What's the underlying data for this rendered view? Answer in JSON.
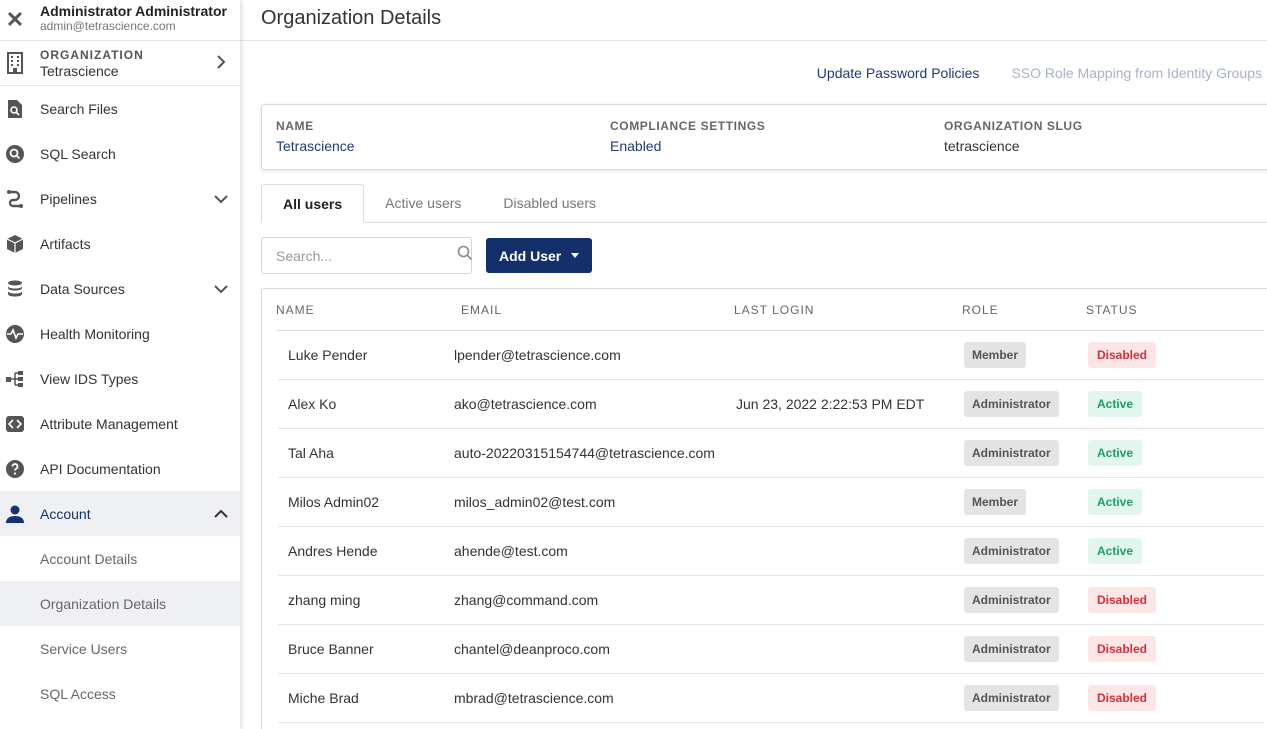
{
  "user": {
    "name": "Administrator Administrator",
    "email": "admin@tetrascience.com"
  },
  "org": {
    "label": "ORGANIZATION",
    "name": "Tetrascience"
  },
  "nav": [
    {
      "id": "search-files",
      "label": "Search Files",
      "icon": "search-file-icon"
    },
    {
      "id": "sql-search",
      "label": "SQL Search",
      "icon": "magnifier-icon"
    },
    {
      "id": "pipelines",
      "label": "Pipelines",
      "icon": "pipeline-icon",
      "chevron": "down"
    },
    {
      "id": "artifacts",
      "label": "Artifacts",
      "icon": "cube-icon"
    },
    {
      "id": "data-sources",
      "label": "Data Sources",
      "icon": "database-icon",
      "chevron": "down"
    },
    {
      "id": "health-monitoring",
      "label": "Health Monitoring",
      "icon": "heartbeat-icon"
    },
    {
      "id": "view-ids-types",
      "label": "View IDS Types",
      "icon": "hierarchy-icon"
    },
    {
      "id": "attribute-management",
      "label": "Attribute Management",
      "icon": "code-icon"
    },
    {
      "id": "api-documentation",
      "label": "API Documentation",
      "icon": "question-icon"
    },
    {
      "id": "account",
      "label": "Account",
      "icon": "person-icon",
      "chevron": "up",
      "active": true
    }
  ],
  "account_sub": [
    {
      "label": "Account Details"
    },
    {
      "label": "Organization Details",
      "selected": true
    },
    {
      "label": "Service Users"
    },
    {
      "label": "SQL Access"
    }
  ],
  "page": {
    "title": "Organization Details",
    "links": {
      "update_password": "Update Password Policies",
      "sso_mapping": "SSO Role Mapping from Identity Groups"
    }
  },
  "summary": {
    "name_label": "NAME",
    "name_value": "Tetrascience",
    "compliance_label": "COMPLIANCE SETTINGS",
    "compliance_value": "Enabled",
    "slug_label": "ORGANIZATION SLUG",
    "slug_value": "tetrascience"
  },
  "tabs": [
    {
      "label": "All users",
      "active": true
    },
    {
      "label": "Active users"
    },
    {
      "label": "Disabled users"
    }
  ],
  "search": {
    "placeholder": "Search..."
  },
  "add_user_label": "Add User",
  "table": {
    "headers": {
      "name": "NAME",
      "email": "EMAIL",
      "last_login": "LAST LOGIN",
      "role": "ROLE",
      "status": "STATUS"
    },
    "rows": [
      {
        "name": "Luke Pender",
        "email": "lpender@tetrascience.com",
        "last_login": "",
        "role": "Member",
        "status": "Disabled"
      },
      {
        "name": "Alex Ko",
        "email": "ako@tetrascience.com",
        "last_login": "Jun 23, 2022 2:22:53 PM EDT",
        "role": "Administrator",
        "status": "Active"
      },
      {
        "name": "Tal Aha",
        "email": "auto-20220315154744@tetrascience.com",
        "last_login": "",
        "role": "Administrator",
        "status": "Active"
      },
      {
        "name": "Milos Admin02",
        "email": "milos_admin02@test.com",
        "last_login": "",
        "role": "Member",
        "status": "Active"
      },
      {
        "name": "Andres Hende",
        "email": "ahende@test.com",
        "last_login": "",
        "role": "Administrator",
        "status": "Active"
      },
      {
        "name": "zhang ming",
        "email": "zhang@command.com",
        "last_login": "",
        "role": "Administrator",
        "status": "Disabled"
      },
      {
        "name": "Bruce Banner",
        "email": "chantel@deanproco.com",
        "last_login": "",
        "role": "Administrator",
        "status": "Disabled"
      },
      {
        "name": "Miche  Brad",
        "email": "mbrad@tetrascience.com",
        "last_login": "",
        "role": "Administrator",
        "status": "Disabled"
      }
    ]
  }
}
